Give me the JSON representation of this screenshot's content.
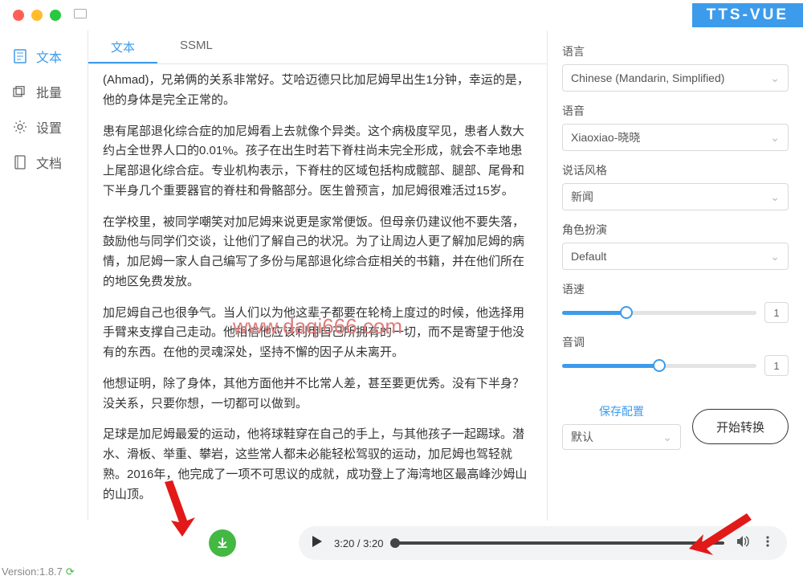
{
  "app": {
    "title": "TTS-VUE"
  },
  "sidebar": {
    "items": [
      {
        "label": "文本",
        "icon": "document"
      },
      {
        "label": "批量",
        "icon": "batch"
      },
      {
        "label": "设置",
        "icon": "gear"
      },
      {
        "label": "文档",
        "icon": "docs"
      }
    ]
  },
  "tabs": {
    "text": "文本",
    "ssml": "SSML"
  },
  "body": {
    "p1": "(Ahmad)，兄弟俩的关系非常好。艾哈迈德只比加尼姆早出生1分钟，幸运的是，他的身体是完全正常的。",
    "p2": "患有尾部退化综合症的加尼姆看上去就像个异类。这个病极度罕见，患者人数大约占全世界人口的0.01%。孩子在出生时若下脊柱尚未完全形成，就会不幸地患上尾部退化综合症。专业机构表示，下脊柱的区域包括构成髋部、腿部、尾骨和下半身几个重要器官的脊柱和骨骼部分。医生曾预言，加尼姆很难活过15岁。",
    "p3": "在学校里，被同学嘲笑对加尼姆来说更是家常便饭。但母亲仍建议他不要失落，鼓励他与同学们交谈，让他们了解自己的状况。为了让周边人更了解加尼姆的病情，加尼姆一家人自己编写了多份与尾部退化综合症相关的书籍，并在他们所在的地区免费发放。",
    "p4": "加尼姆自己也很争气。当人们以为他这辈子都要在轮椅上度过的时候，他选择用手臂来支撑自己走动。他相信他应该利用自己所拥有的一切，而不是寄望于他没有的东西。在他的灵魂深处，坚持不懈的因子从未离开。",
    "p5": "他想证明，除了身体，其他方面他并不比常人差，甚至要更优秀。没有下半身？没关系，只要你想，一切都可以做到。",
    "p6": "足球是加尼姆最爱的运动，他将球鞋穿在自己的手上，与其他孩子一起踢球。潜水、滑板、举重、攀岩，这些常人都未必能轻松驾驭的运动，加尼姆也驾轻就熟。2016年，他完成了一项不可思议的成就，成功登上了海湾地区最高峰沙姆山的山顶。"
  },
  "watermark": "www.daqi666.com",
  "right": {
    "lang_label": "语言",
    "lang_value": "Chinese (Mandarin, Simplified)",
    "voice_label": "语音",
    "voice_value": "Xiaoxiao-晓晓",
    "style_label": "说话风格",
    "style_value": "新闻",
    "role_label": "角色扮演",
    "role_value": "Default",
    "speed_label": "语速",
    "speed_value": "1",
    "pitch_label": "音调",
    "pitch_value": "1",
    "save_label": "保存配置",
    "preset_value": "默认",
    "start_label": "开始转换"
  },
  "player": {
    "time": "3:20 / 3:20"
  },
  "version": "Version:1.8.7"
}
